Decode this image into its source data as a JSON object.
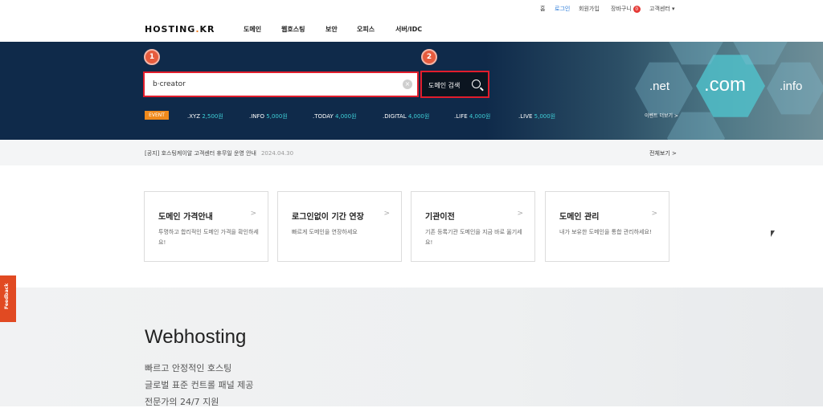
{
  "top_util": {
    "home": "홈",
    "login": "로그인",
    "signup": "회원가입",
    "cart": "장바구니",
    "cart_count": "0",
    "support": "고객센터 ▾"
  },
  "header": {
    "logo_text": "HOSTING",
    "logo_dot": ".",
    "logo_suffix": "KR",
    "menu": [
      "도메인",
      "웹호스팅",
      "보안",
      "오피스",
      "서버/IDC"
    ]
  },
  "hero": {
    "search_value": "b·creator",
    "clear_symbol": "×",
    "search_button_label": "도메인 검색",
    "marker_1": "1",
    "marker_2": "2",
    "event_badge": "EVENT",
    "prices": [
      {
        "tld": ".XYZ",
        "amount": "2,500원"
      },
      {
        "tld": ".INFO",
        "amount": "5,000원"
      },
      {
        "tld": ".TODAY",
        "amount": "4,000원"
      },
      {
        "tld": ".DIGITAL",
        "amount": "4,000원"
      },
      {
        "tld": ".LIFE",
        "amount": "4,000원"
      },
      {
        "tld": ".LIVE",
        "amount": "5,000원"
      }
    ],
    "hex_labels": [
      ".net",
      ".com",
      ".info"
    ],
    "more_events": "이벤트 더보기 >",
    "accent_color": "#e11d2c"
  },
  "notice": {
    "text": "[공지] 호스팅케이알 고객센터 휴무일 운영 안내",
    "date": "2024.04.30",
    "view_all": "전체보기 >"
  },
  "cards": [
    {
      "title": "도메인 가격안내",
      "desc": "투명하고 합리적인 도메인 가격을 확인하세요!",
      "arrow": ">"
    },
    {
      "title": "로그인없이 기간 연장",
      "desc": "빠르게 도메인을 연장하세요",
      "arrow": ">"
    },
    {
      "title": "기관이전",
      "desc": "기존 등록기관 도메인을 지금 바로 옮기세요!",
      "arrow": ">"
    },
    {
      "title": "도메인 관리",
      "desc": "내가 보유한 도메인을 통합 관리하세요!",
      "arrow": ">"
    }
  ],
  "webhosting": {
    "title": "Webhosting",
    "lines": [
      "빠르고 안정적인 호스팅",
      "글로벌 표준 컨트롤 패널 제공",
      "전문가의 24/7 지원"
    ]
  },
  "feedback": {
    "label": "Feedback"
  }
}
